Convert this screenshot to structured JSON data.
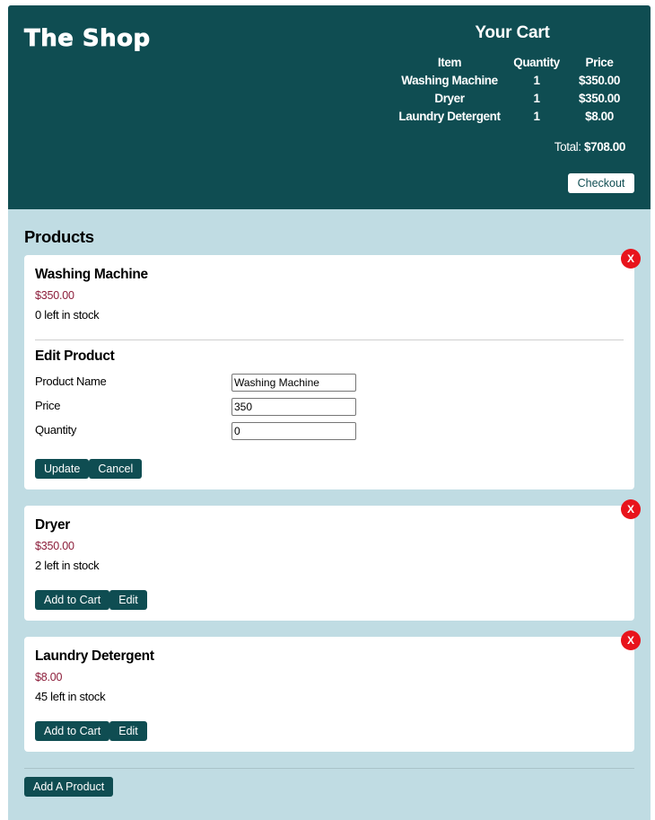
{
  "header": {
    "logo": "The Shop",
    "cart": {
      "title": "Your Cart",
      "columns": [
        "Item",
        "Quantity",
        "Price"
      ],
      "rows": [
        {
          "item": "Washing Machine",
          "quantity": "1",
          "price": "$350.00"
        },
        {
          "item": "Dryer",
          "quantity": "1",
          "price": "$350.00"
        },
        {
          "item": "Laundry Detergent",
          "quantity": "1",
          "price": "$8.00"
        }
      ],
      "total_label": "Total:",
      "total_value": "$708.00",
      "checkout_label": "Checkout"
    }
  },
  "products": {
    "title": "Products",
    "delete_label": "X",
    "items": [
      {
        "name": "Washing Machine",
        "price": "$350.00",
        "stock": "0 left in stock",
        "edit": {
          "title": "Edit Product",
          "name_label": "Product Name",
          "name_value": "Washing Machine",
          "price_label": "Price",
          "price_value": "350",
          "quantity_label": "Quantity",
          "quantity_value": "0",
          "update_label": "Update",
          "cancel_label": "Cancel"
        }
      },
      {
        "name": "Dryer",
        "price": "$350.00",
        "stock": "2 left in stock",
        "add_label": "Add to Cart",
        "edit_label": "Edit"
      },
      {
        "name": "Laundry Detergent",
        "price": "$8.00",
        "stock": "45 left in stock",
        "add_label": "Add to Cart",
        "edit_label": "Edit"
      }
    ],
    "add_product_label": "Add A Product"
  },
  "colors": {
    "header_bg": "#0f4d52",
    "page_bg": "#c0dce3",
    "price_text": "#8c1d3a",
    "delete_bg": "#e8141c"
  }
}
